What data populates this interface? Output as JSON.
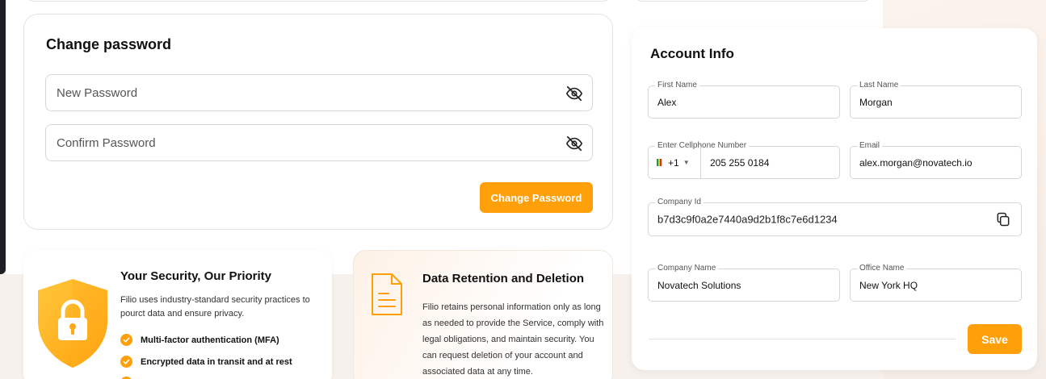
{
  "change_password": {
    "title": "Change password",
    "new_password_placeholder": "New Password",
    "confirm_password_placeholder": "Confirm Password",
    "submit_label": "Change Password"
  },
  "account_info": {
    "title": "Account Info",
    "first_name": {
      "label": "First Name",
      "value": "Alex"
    },
    "last_name": {
      "label": "Last Name",
      "value": "Morgan"
    },
    "phone": {
      "label": "Enter Cellphone Number",
      "country_code": "+1",
      "value": "205 255 0184"
    },
    "email": {
      "label": "Email",
      "value": "alex.morgan@novatech.io"
    },
    "company_id": {
      "label": "Company Id",
      "value": "b7d3c9f0a2e7440a9d2b1f8c7e6d1234"
    },
    "company_name": {
      "label": "Company Name",
      "value": "Novatech Solutions"
    },
    "office_name": {
      "label": "Office Name",
      "value": "New York HQ"
    },
    "save_label": "Save"
  },
  "security": {
    "title": "Your Security, Our Priority",
    "description": "Filio uses industry-standard security practices to pourct data and ensure privacy.",
    "items": [
      "Multi-factor authentication (MFA)",
      "Encrypted data in transit and at rest"
    ]
  },
  "data_retention": {
    "title": "Data Retention and Deletion",
    "description": "Filio retains personal information only as long as needed to provide the Service, comply with legal obligations, and maintain security. You can request deletion of your account and associated data at any time."
  },
  "icons": {
    "password_visibility": "eye-off-icon",
    "copy": "copy-icon",
    "shield": "shield-lock-icon",
    "document": "document-icon",
    "check": "check-circle-icon"
  },
  "colors": {
    "accent": "#ff9f0a",
    "accent_light": "#ffc83d"
  }
}
